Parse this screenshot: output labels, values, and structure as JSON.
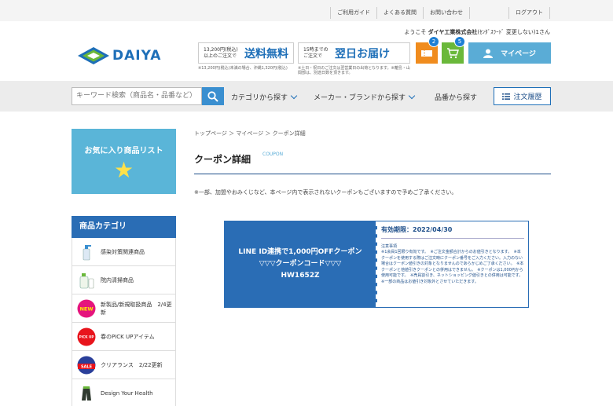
{
  "topnav": {
    "items": [
      "ご利用ガイド",
      "よくある質問",
      "お問い合わせ",
      "ログアウト"
    ]
  },
  "welcome": {
    "prefix": "ようこそ",
    "company": "ダイヤ工業株式会社",
    "suffix": "(ｾﾝﾀﾞｽﾗｰﾄﾞ 変更しない)1さん"
  },
  "logo": {
    "text": "DAIYA"
  },
  "promo_shipping": {
    "condition": "13,200円(税込)以上のご注文で",
    "headline": "送料無料",
    "note": "※13,200円(税込)未満の場合、沖縄1,320円(税込)"
  },
  "promo_delivery": {
    "condition": "15時までのご注文で",
    "headline": "翌日お届け",
    "note": "※土日・祝日のご注文は翌営業日の出荷となります。※離島・山間部は、別途日数を頂きます。"
  },
  "header_icons": {
    "history_badge": "2",
    "cart_badge": "5"
  },
  "mypage": {
    "label": "マイページ"
  },
  "search": {
    "placeholder": "キーワード検索（商品名・品番など）"
  },
  "nav": {
    "category": "カテゴリから探す",
    "maker": "メーカー・ブランドから探す",
    "part_number": "品番から探す",
    "order_history": "注文履歴"
  },
  "sidebar": {
    "favorites_title": "お気に入り商品リスト",
    "category_header": "商品カテゴリ",
    "categories": [
      "感染対策関連商品",
      "院内清掃商品",
      "新製品/新規取扱商品　2/4更新",
      "春のPICK UPアイテム",
      "クリアランス　2/22更新",
      "Design Your Health"
    ],
    "icon_new": "NEW",
    "icon_pickup": "PICK UP",
    "icon_sale": "SALE"
  },
  "main": {
    "breadcrumb": "トップページ ＞ マイページ ＞ クーポン詳細",
    "title": "クーポン詳細",
    "subtitle": "COUPON",
    "notice": "※一部、加盟やおみくじなど、本ページ内で表示されないクーポンもございますので予めご了承ください。"
  },
  "coupon": {
    "line1": "LINE ID連携で1,000円OFFクーポン",
    "line2": "▽▽▽クーポンコード▽▽▽",
    "code": "HW1652Z",
    "expiry": "有効期限：2022/04/30",
    "terms_title": "注意事項",
    "terms": "※1会員1回限り有効です。　※ご注文金額合計からのお値引きとなります。　※本クーポンを使用する際はご注文時にクーポン番号をご入力ください。入力のない場合はクーポン値引きの対象となりませんのであらかじめご了承ください。　※本クーポンと他値引きクーポンとの併用はできません。　※クーポンは1,000円から使用可能です。　※売員割引き、ネットショッピング値引きとの併用は可能です。　※一部の商品はお値引き対象外とさせていただきます。"
  },
  "colors": {
    "brand_blue": "#1e6fb8",
    "coupon_blue": "#2a6db5",
    "light_blue": "#5ab5d8",
    "orange": "#f08c1e",
    "green": "#6ab83a"
  }
}
